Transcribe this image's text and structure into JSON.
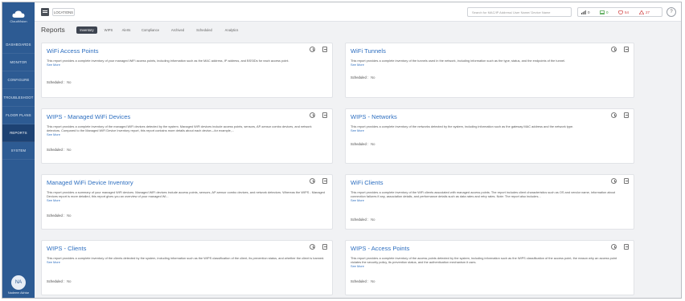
{
  "app": {
    "name": "CloudVision"
  },
  "sidebar": {
    "items": [
      {
        "label": "DASHBOARDS"
      },
      {
        "label": "MONITOR"
      },
      {
        "label": "CONFIGURE"
      },
      {
        "label": "TROUBLESHOOT"
      },
      {
        "label": "FLOOR PLANS"
      },
      {
        "label": "REPORTS"
      },
      {
        "label": "SYSTEM"
      }
    ],
    "user": {
      "initials": "NA",
      "name": "Nadeem Akhtar"
    }
  },
  "topbar": {
    "locations_label": "LOCATIONS",
    "search_placeholder": "Search for MAC/IP Address/ User Name/ Device Name",
    "status": {
      "devices": "0",
      "clients": "0",
      "wips": "54",
      "alerts": "27"
    },
    "help_label": "?"
  },
  "page": {
    "title": "Reports",
    "tabs": [
      "Inventory",
      "WIPS",
      "Alerts",
      "Compliance",
      "Archived",
      "Scheduled",
      "Analytics"
    ]
  },
  "colors": {
    "sidebar": "#2d5b93",
    "accent": "#2e6fc0",
    "active_tab": "#3d4450"
  },
  "cards": [
    {
      "title": "WiFi Access Points",
      "desc": "This report provides a complete inventory of your managed WiFi access points, including information such as the MAC address, IP address, and BSSIDs for each access point.",
      "see_more": "See More",
      "scheduled_label": "Scheduled :",
      "scheduled_value": "No"
    },
    {
      "title": "WiFi Tunnels",
      "desc": "This report provides a complete inventory of the tunnels used in the network, including information such as the type, status, and the endpoints of the tunnel.",
      "see_more": "See More",
      "scheduled_label": "Scheduled :",
      "scheduled_value": "No"
    },
    {
      "title": "WIPS - Managed WiFi Devices",
      "desc": "This report provides a complete inventory of the managed WiFi devices detected by the system. Managed WiFi devices include access points, sensors, AP-sensor combo devices, and network detectors. Compared to the Managed WiFi Device Inventory report, this report contains more details about each device—for example,...",
      "see_more": "See More",
      "scheduled_label": "Scheduled :",
      "scheduled_value": "No"
    },
    {
      "title": "WIPS - Networks",
      "desc": "This report provides a complete inventory of the networks detected by the system, including information such as the gateway MAC address and the network type.",
      "see_more": "See More",
      "scheduled_label": "Scheduled :",
      "scheduled_value": "No"
    },
    {
      "title": "Managed WiFi Device Inventory",
      "desc": "This report provides a summary of your managed WiFi devices. Managed WiFi devices include access points, sensors, AP-sensor combo devices, and network detectors. Whereas the WIPS - Managed Devices report is more detailed, this report gives you an overview of your managed Wi...",
      "see_more": "See More",
      "scheduled_label": "Scheduled :",
      "scheduled_value": "No"
    },
    {
      "title": "WiFi Clients",
      "desc": "This report provides a complete inventory of the WiFi clients associated with managed access points. The report includes client characteristics such as OS and vendor name, information about connection failures if any, association details, and performance details such as data rates and retry rates. Note: The report also includes...",
      "see_more": "See More",
      "scheduled_label": "Scheduled :",
      "scheduled_value": "No"
    },
    {
      "title": "WIPS - Clients",
      "desc": "This report provides a complete inventory of the clients detected by the system, including information such as the WIPS classification of the client, its prevention status, and whether the client is banned.",
      "see_more": "See More",
      "scheduled_label": "Scheduled :",
      "scheduled_value": "No"
    },
    {
      "title": "WIPS - Access Points",
      "desc": "This report provides a complete inventory of the access points detected by the system, including information such as the WIPS classification of the access point, the reason why an access point violates the security policy, its prevention status, and the authentication mechanism it uses.",
      "see_more": "See More",
      "scheduled_label": "Scheduled :",
      "scheduled_value": "No"
    }
  ]
}
